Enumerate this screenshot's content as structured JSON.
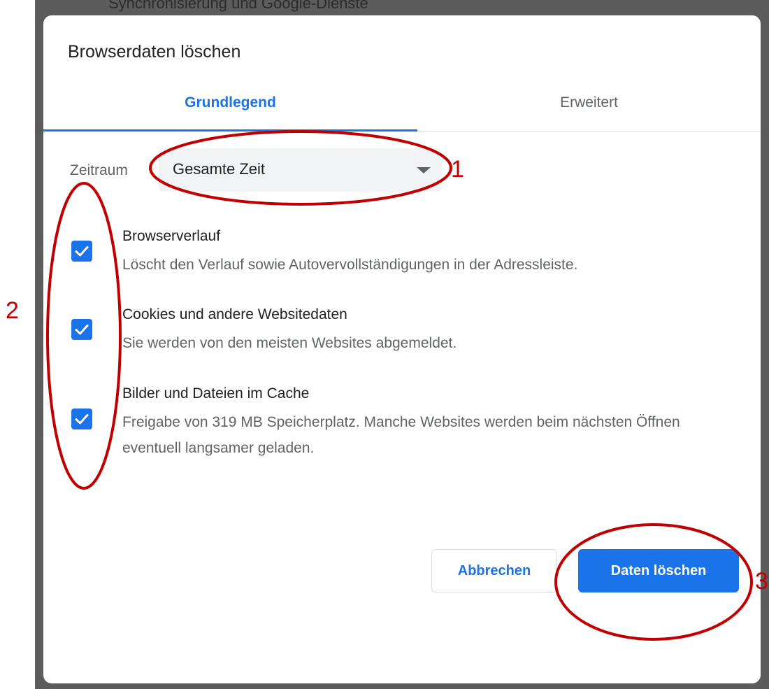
{
  "background": {
    "partial_text": "Synchronisierung und Google-Dienste"
  },
  "dialog": {
    "title": "Browserdaten löschen",
    "tabs": [
      {
        "label": "Grundlegend",
        "active": true
      },
      {
        "label": "Erweitert",
        "active": false
      }
    ],
    "time_range": {
      "label": "Zeitraum",
      "selected": "Gesamte Zeit"
    },
    "options": [
      {
        "title": "Browserverlauf",
        "description": "Löscht den Verlauf sowie Autovervollständigungen in der Adressleiste.",
        "checked": true
      },
      {
        "title": "Cookies und andere Websitedaten",
        "description": "Sie werden von den meisten Websites abgemeldet.",
        "checked": true
      },
      {
        "title": "Bilder und Dateien im Cache",
        "description": "Freigabe von 319 MB Speicherplatz. Manche Websites werden beim nächsten Öffnen eventuell langsamer geladen.",
        "checked": true
      }
    ],
    "buttons": {
      "cancel": "Abbrechen",
      "confirm": "Daten löschen"
    }
  },
  "annotations": {
    "labels": [
      "1",
      "2",
      "3"
    ],
    "color": "#c00000"
  },
  "colors": {
    "accent": "#1a73e8",
    "text_primary": "#202124",
    "text_secondary": "#5f6368",
    "annotation": "#c00000"
  }
}
